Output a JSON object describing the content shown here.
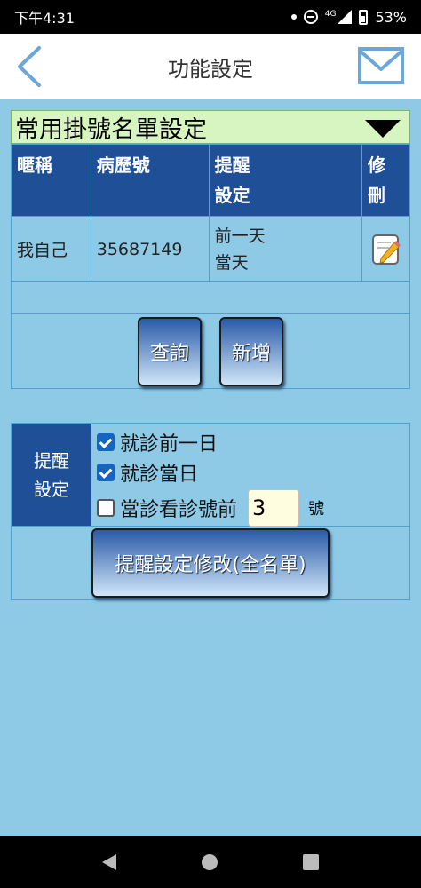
{
  "status_bar": {
    "time": "下午4:31",
    "network": "4G",
    "battery": "53%"
  },
  "header": {
    "title": "功能設定",
    "back_icon": "chevron-left-icon",
    "mail_icon": "mail-icon"
  },
  "list_select": {
    "value": "常用掛號名單設定"
  },
  "table": {
    "headers": [
      "暱稱",
      "病歷號",
      "提醒\n設定",
      "修\n刪"
    ],
    "rows": [
      {
        "nickname": "我自己",
        "record_no": "35687149",
        "reminder_1": "前一天",
        "reminder_2": "當天"
      }
    ]
  },
  "buttons": {
    "query": "查詢",
    "add": "新增",
    "update": "提醒設定修改(全名單)"
  },
  "reminder": {
    "label_1": "提醒",
    "label_2": "設定",
    "options": [
      {
        "label": "就診前一日",
        "checked": true
      },
      {
        "label": "就診當日",
        "checked": true
      },
      {
        "label": "當診看診號前",
        "checked": false
      }
    ],
    "number": "3",
    "unit": "號"
  },
  "colors": {
    "background": "#8ec9e6",
    "header_blue": "#1f4f96",
    "select_green": "#d7f5c0"
  }
}
